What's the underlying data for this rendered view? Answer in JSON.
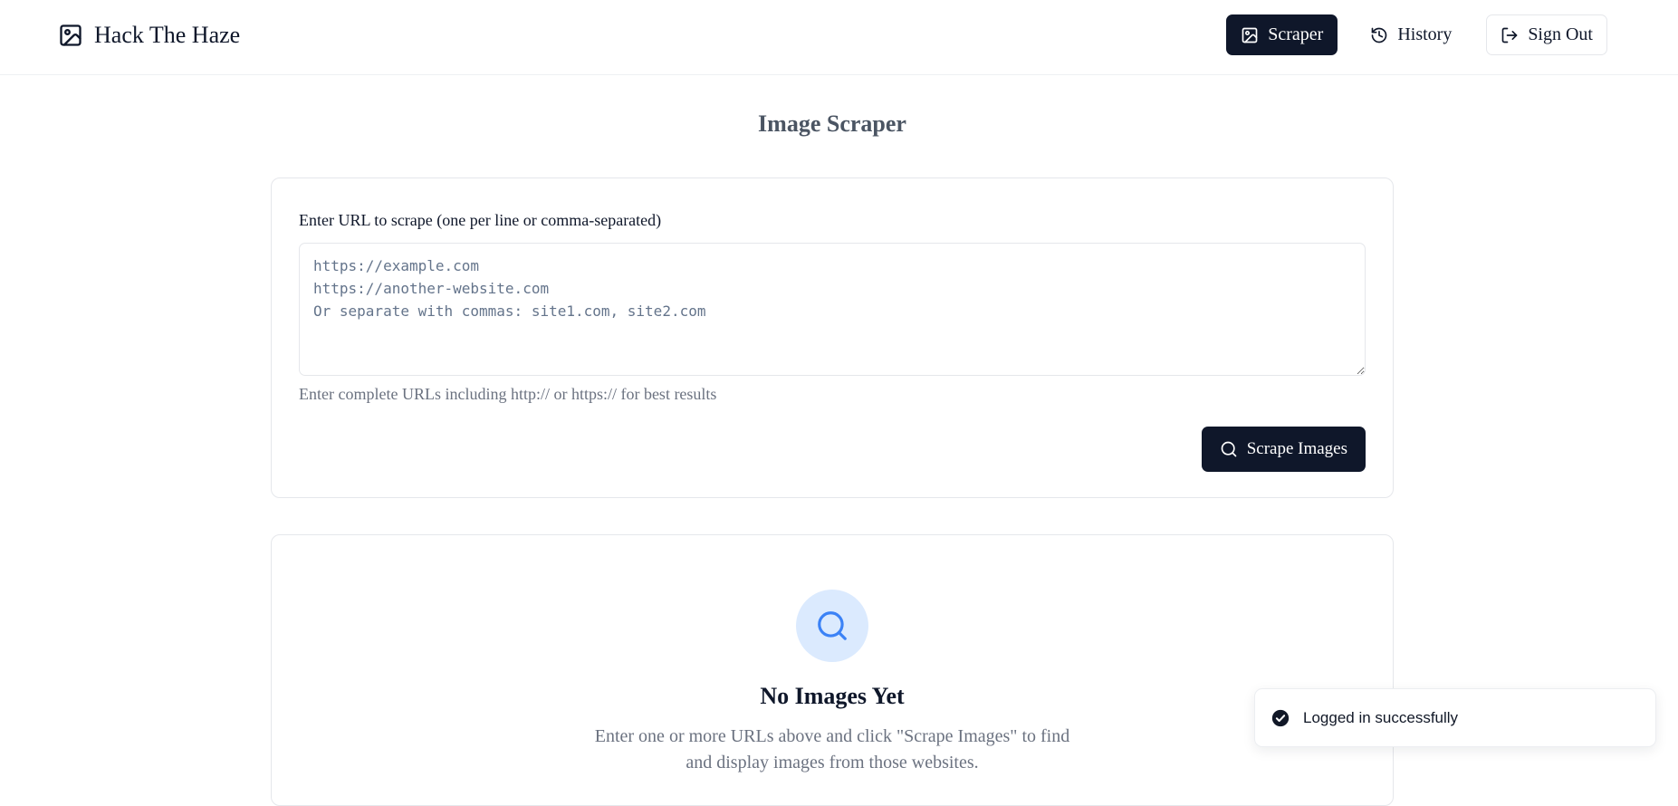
{
  "header": {
    "brand": {
      "name": "Hack The Haze",
      "icon": "image-icon"
    },
    "nav": [
      {
        "id": "scraper",
        "label": "Scraper",
        "icon": "image-icon",
        "active": true
      },
      {
        "id": "history",
        "label": "History",
        "icon": "history-icon",
        "active": false
      },
      {
        "id": "sign_out",
        "label": "Sign Out",
        "icon": "sign-out-icon",
        "active": false
      }
    ]
  },
  "page": {
    "title": "Image Scraper"
  },
  "form": {
    "label": "Enter URL to scrape (one per line or comma-separated)",
    "textarea": {
      "value": "",
      "placeholder": "https://example.com\nhttps://another-website.com\nOr separate with commas: site1.com, site2.com"
    },
    "helper": "Enter complete URLs including http:// or https:// for best results",
    "submit_label": "Scrape Images",
    "submit_icon": "search-icon"
  },
  "empty_state": {
    "icon": "search-icon",
    "title": "No Images Yet",
    "description": "Enter one or more URLs above and click \"Scrape Images\" to find and display images from those websites."
  },
  "toast": {
    "icon": "check-circle-icon",
    "message": "Logged in successfully"
  },
  "colors": {
    "primary": "#0f172a",
    "accent_blue": "#3b82f6",
    "accent_blue_bg": "#dbeafe",
    "muted_text": "#6b7280",
    "border": "#e5e7eb"
  }
}
